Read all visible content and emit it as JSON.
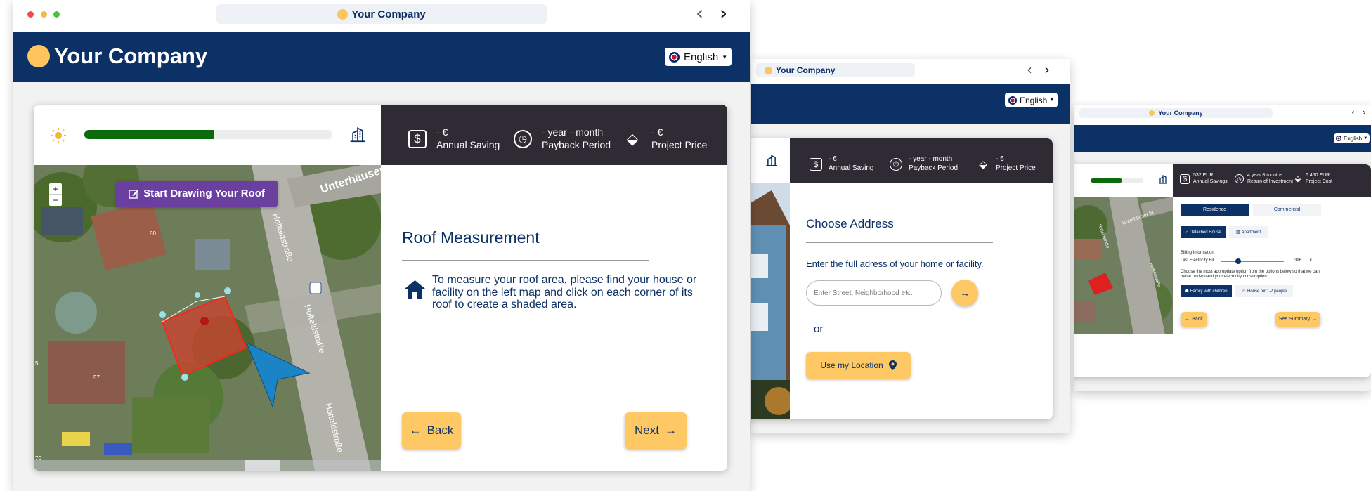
{
  "brand": {
    "name": "Your Company",
    "accent": "#fdc55c",
    "navy": "#0b3166"
  },
  "language": {
    "selected": "English"
  },
  "metrics": {
    "saving_value": "- €",
    "saving_label": "Annual Saving",
    "payback_value": "- year - month",
    "payback_label": "Payback Period",
    "price_value": "- €",
    "price_label": "Project Price"
  },
  "screen1": {
    "progress": 0.52,
    "draw_button": "Start Drawing Your Roof",
    "zoom_in": "+",
    "zoom_out": "−",
    "title": "Roof Measurement",
    "instructions": "To measure your roof area, please find your house or facility on the left map and click on each corner of its roof to create a shaded area.",
    "back": "Back",
    "next": "Next",
    "street_labels": [
      "Unterhäuser St",
      "Hofteldstraße",
      "Hofteldstraße",
      "Hofteldstraße"
    ],
    "house_numbers": [
      "80",
      "57",
      "5",
      "70"
    ]
  },
  "screen2": {
    "title": "Choose Address",
    "prompt": "Enter the full adress of your home or facility.",
    "address_placeholder": "Enter Street, Neighborhood etc.",
    "or": "or",
    "location_button": "Use my Location"
  },
  "screen3": {
    "progress": 0.6,
    "metrics": {
      "saving_value": "532 EUR",
      "saving_label": "Annual Savings",
      "roi_value": "4 year 8 months",
      "roi_label": "Return of Investment",
      "cost_value": "6.450 EUR",
      "cost_label": "Project Cost"
    },
    "tab_residence": "Residence",
    "tab_commercial": "Commercial",
    "type_detached": "Detached House",
    "type_apartment": "Apartment",
    "billing_heading": "Billing Information",
    "bill_label": "Last Electricity Bill",
    "bill_value": "396",
    "bill_unit": "€",
    "bill_fraction": 0.28,
    "choose_text": "Choose the most appropriate option from the options below so that we can better understand your electricity consumption.",
    "family": "Family with children",
    "house_people": "House for 1-2 people",
    "back": "Back",
    "summary": "See Summary",
    "street_labels": [
      "Unterhäuser St",
      "Hofteldstraße",
      "Hofteldstraße"
    ]
  }
}
